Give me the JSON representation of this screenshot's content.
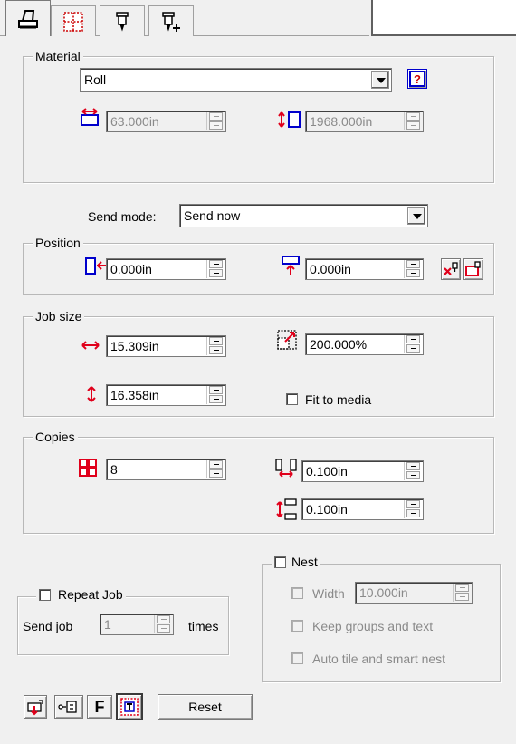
{
  "tabs": [
    {
      "icon": "printer-job-icon",
      "active": true
    },
    {
      "icon": "layout-grid-icon",
      "active": false
    },
    {
      "icon": "cutter-tool-icon",
      "active": false
    },
    {
      "icon": "cutter-tool-add-icon",
      "active": false
    }
  ],
  "material": {
    "title": "Material",
    "selected": "Roll",
    "width": "63.000in",
    "length": "1968.000in"
  },
  "send_mode": {
    "label": "Send mode:",
    "selected": "Send now"
  },
  "position": {
    "title": "Position",
    "x": "0.000in",
    "y": "0.000in"
  },
  "job_size": {
    "title": "Job size",
    "width": "15.309in",
    "height": "16.358in",
    "scale": "200.000%",
    "fit_label": "Fit to media",
    "fit_checked": false
  },
  "copies": {
    "title": "Copies",
    "count": "8",
    "h_spacing": "0.100in",
    "v_spacing": "0.100in"
  },
  "nest": {
    "label": "Nest",
    "checked": false,
    "width_label": "Width",
    "width_value": "10.000in",
    "keep_groups_label": "Keep groups and text",
    "auto_tile_label": "Auto tile and smart nest"
  },
  "repeat": {
    "label": "Repeat Job",
    "checked": false,
    "send_job_label": "Send job",
    "times_value": "1",
    "times_label": "times"
  },
  "toolbar": {
    "f_label": "F",
    "reset_label": "Reset"
  },
  "colors": {
    "accent_red": "#e0001b",
    "accent_blue": "#0000cc"
  }
}
